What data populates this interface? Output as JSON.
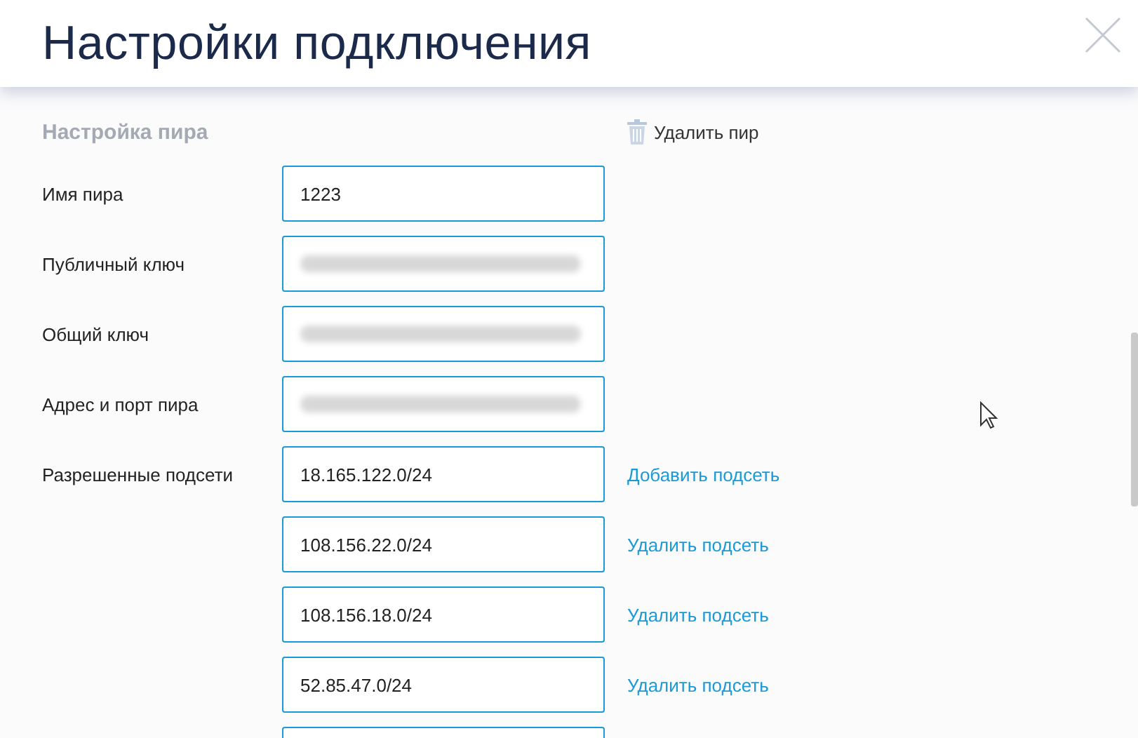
{
  "header": {
    "title": "Настройки подключения"
  },
  "section": {
    "title": "Настройка пира",
    "delete_action": "Удалить пир"
  },
  "fields": [
    {
      "label": "Имя пира",
      "kind": "text",
      "value": "1223"
    },
    {
      "label": "Публичный ключ",
      "kind": "blurred"
    },
    {
      "label": "Общий ключ",
      "kind": "blurred"
    },
    {
      "label": "Адрес и порт пира",
      "kind": "blurred"
    }
  ],
  "subnets": {
    "label": "Разрешенные подсети",
    "items": [
      {
        "kind": "text",
        "value": "18.165.122.0/24",
        "action": "Добавить подсеть"
      },
      {
        "kind": "text",
        "value": "108.156.22.0/24",
        "action": "Удалить подсеть"
      },
      {
        "kind": "text",
        "value": "108.156.18.0/24",
        "action": "Удалить подсеть"
      },
      {
        "kind": "text",
        "value": "52.85.47.0/24",
        "action": "Удалить подсеть"
      },
      {
        "kind": "empty"
      }
    ]
  }
}
